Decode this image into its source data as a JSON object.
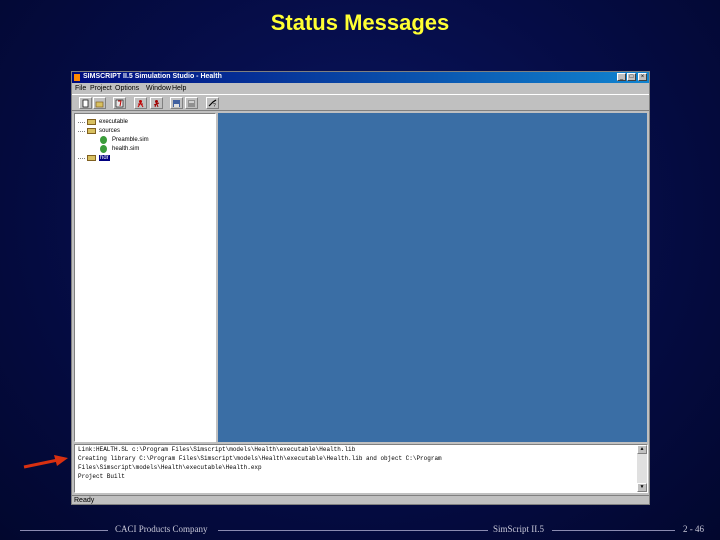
{
  "slide": {
    "title": "Status Messages"
  },
  "window": {
    "title": "SIMSCRIPT II.5 Simulation Studio - Health",
    "buttons": {
      "minimize": "_",
      "maximize": "□",
      "close": "×"
    }
  },
  "menu": {
    "items": [
      "File",
      "Project",
      "Options",
      "Window",
      "Help"
    ]
  },
  "toolbar": {
    "icons": [
      "new-icon",
      "open-icon",
      "build-icon",
      "run-icon",
      "debug-icon",
      "save-icon",
      "disk-icon",
      "help-icon"
    ]
  },
  "tree": {
    "items": [
      {
        "label": "executable",
        "icon": "folder-icon"
      },
      {
        "label": "sources",
        "icon": "folder-icon"
      },
      {
        "label": "Preamble.sim",
        "icon": "source-file-icon"
      },
      {
        "label": "health.sim",
        "icon": "source-file-icon"
      },
      {
        "label": "hdr",
        "icon": "folder-icon",
        "selected": true
      }
    ]
  },
  "output": {
    "lines": [
      "Link:HEALTH.SL  c:\\Program Files\\Simscript\\models\\Health\\executable\\Health.lib",
      "  Creating library C:\\Program Files\\Simscript\\models\\Health\\executable\\Health.lib and object C:\\Program",
      "Files\\Simscript\\models\\Health\\executable\\Health.exp",
      "Project Built"
    ]
  },
  "status": {
    "text": "Ready"
  },
  "footer": {
    "company": "CACI Products Company",
    "product": "SimScript II.5",
    "page": "2 - 46"
  },
  "colors": {
    "title": "#ffff33",
    "background": "#050c45",
    "mdi_background": "#3a6ea5",
    "arrow": "#d83010"
  }
}
